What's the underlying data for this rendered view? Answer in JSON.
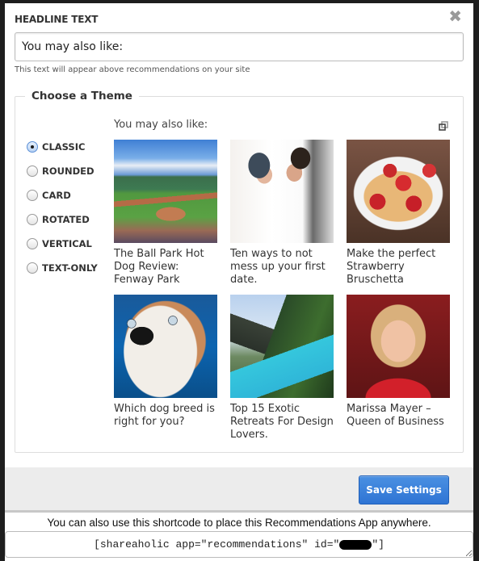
{
  "headline": {
    "label": "HEADLINE TEXT",
    "value": "You may also like:",
    "help": "This text will appear above recommendations on your site"
  },
  "close_icon": "close-icon",
  "theme": {
    "legend": "Choose a Theme",
    "selected": "CLASSIC",
    "options": [
      {
        "label": "CLASSIC",
        "checked": true
      },
      {
        "label": "ROUNDED",
        "checked": false
      },
      {
        "label": "CARD",
        "checked": false
      },
      {
        "label": "ROTATED",
        "checked": false
      },
      {
        "label": "VERTICAL",
        "checked": false
      },
      {
        "label": "TEXT-ONLY",
        "checked": false
      }
    ]
  },
  "preview": {
    "title": "You may also like:",
    "popout_icon": "popout-icon",
    "items": [
      {
        "title": "The Ball Park Hot Dog Review: Fenway Park",
        "image": "baseball-stadium"
      },
      {
        "title": "Ten ways to not mess up your first date.",
        "image": "couple"
      },
      {
        "title": "Make the perfect Strawberry Bruschetta",
        "image": "strawberry-bruschetta"
      },
      {
        "title": "Which dog breed is right for you?",
        "image": "dog"
      },
      {
        "title": "Top 15 Exotic Retreats For Design Lovers.",
        "image": "tropical-pool"
      },
      {
        "title": "Marissa Mayer – Queen of Business",
        "image": "portrait"
      }
    ]
  },
  "footer": {
    "save_label": "Save Settings"
  },
  "shortcode": {
    "note": "You can also use this shortcode to place this Recommendations App anywhere.",
    "prefix": "[shareaholic app=\"recommendations\" id=\"",
    "suffix": "\"]"
  },
  "colors": {
    "accent": "#3a82dc",
    "overlay": "#1e1e1e"
  }
}
